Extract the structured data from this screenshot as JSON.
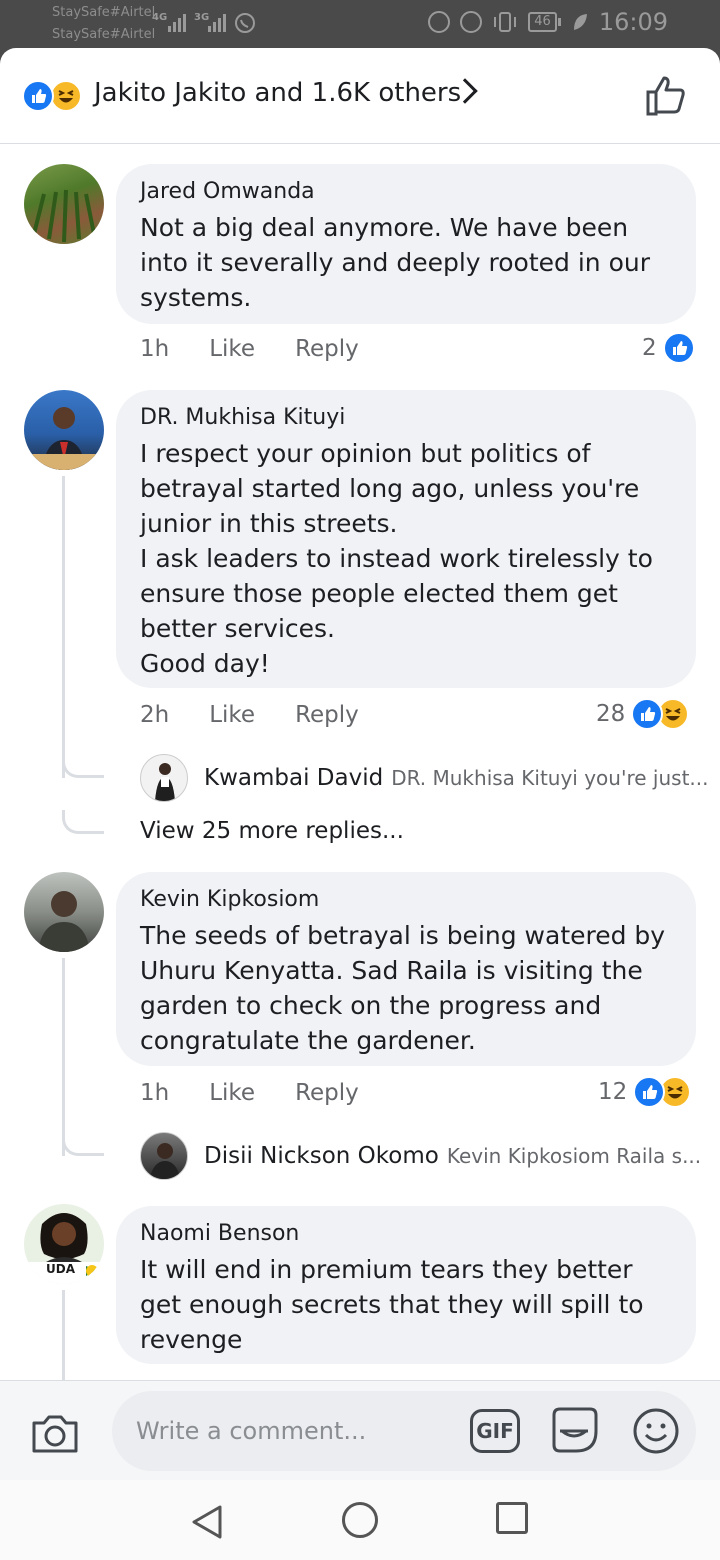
{
  "status_bar": {
    "carrier_1": "StaySafe#Airtel",
    "carrier_2": "StaySafe#Airtel",
    "net_1": "4G",
    "net_2": "3G",
    "battery": "46",
    "time": "16:09"
  },
  "reactions_header": {
    "summary": "Jakito Jakito and 1.6K others"
  },
  "comments": [
    {
      "name": "Jared Omwanda",
      "text": "Not a big deal anymore. We have been into it severally and deeply rooted in our systems.",
      "time": "1h",
      "like_label": "Like",
      "reply_label": "Reply",
      "reaction_count": "2"
    },
    {
      "name": "DR. Mukhisa Kituyi",
      "text": "I respect your opinion but politics of betrayal started long ago, unless you're junior in this streets.\nI ask leaders to instead work tirelessly to ensure those people elected them get better services.\nGood day!",
      "time": "2h",
      "like_label": "Like",
      "reply_label": "Reply",
      "reaction_count": "28",
      "reply_preview": {
        "name": "Kwambai David",
        "text": "DR. Mukhisa Kituyi you're just..."
      },
      "view_more": "View 25 more replies..."
    },
    {
      "name": "Kevin Kipkosiom",
      "text": "The seeds of betrayal is being watered by Uhuru Kenyatta. Sad Raila is visiting the garden to check on the progress and congratulate the gardener.",
      "time": "1h",
      "like_label": "Like",
      "reply_label": "Reply",
      "reaction_count": "12",
      "reply_preview": {
        "name": "Disii Nickson Okomo",
        "text": "Kevin Kipkosiom Raila s..."
      }
    },
    {
      "name": "Naomi Benson",
      "text": "It will end in premium tears they better get enough secrets that they will spill to revenge",
      "avatar_badge": "UDA"
    }
  ],
  "compose": {
    "placeholder": "Write a comment...",
    "gif_label": "GIF"
  },
  "colors": {
    "facebook_blue": "#1877f2",
    "haha_yellow": "#f7b928",
    "bubble_gray": "#f0f2f5"
  }
}
